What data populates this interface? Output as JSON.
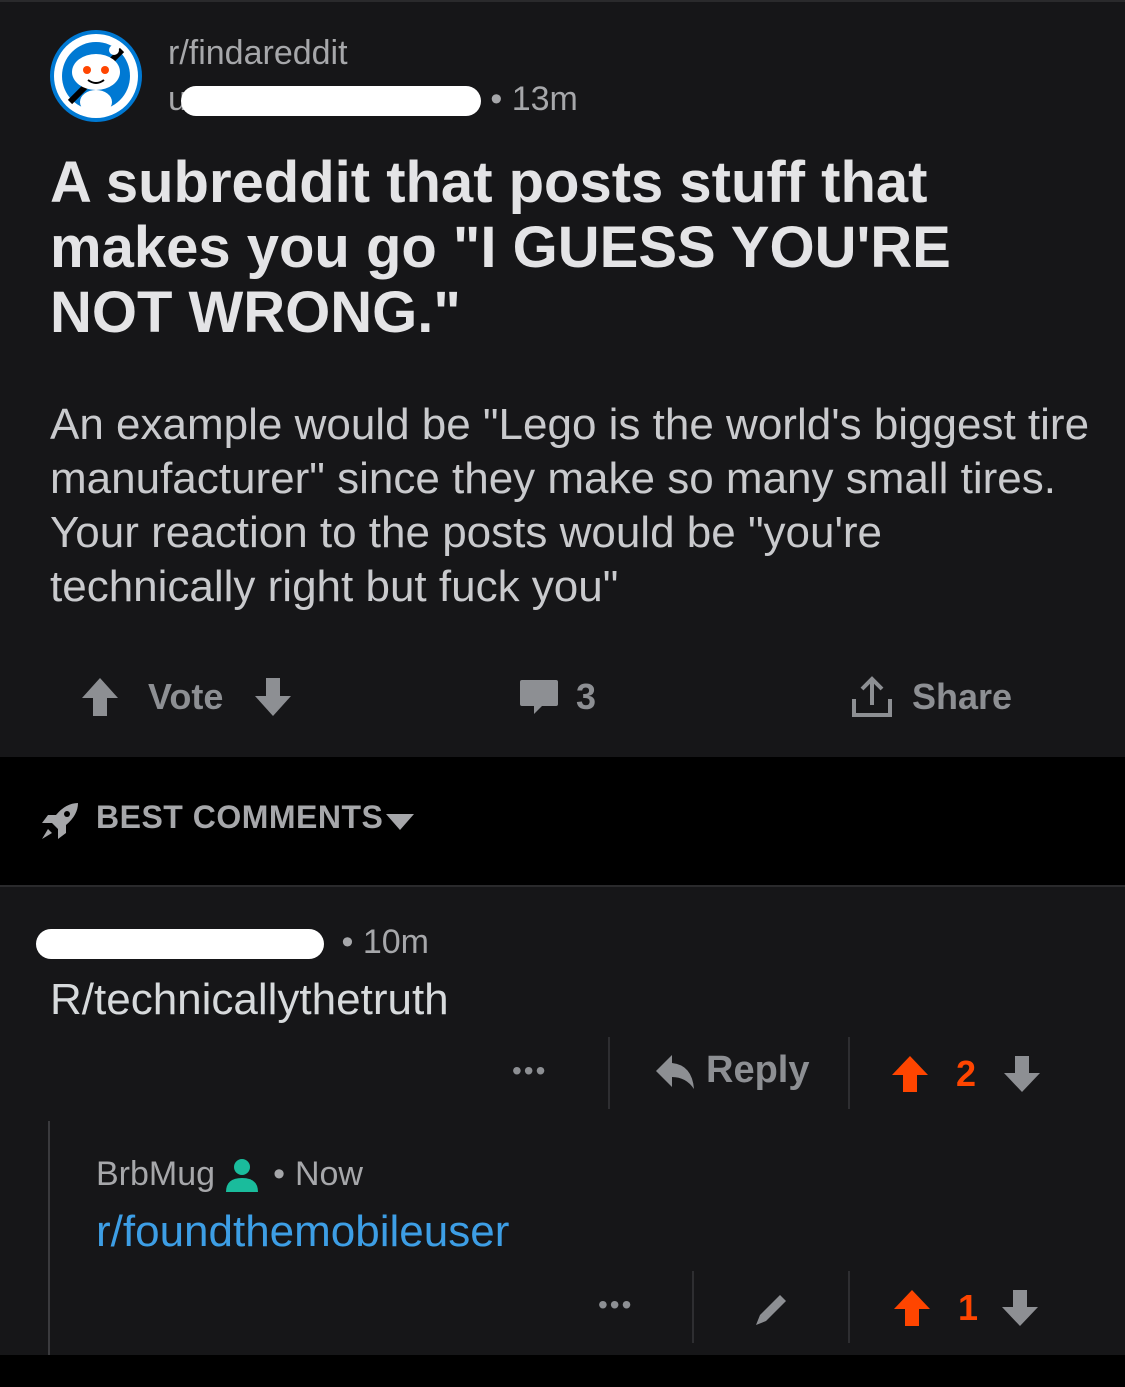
{
  "post": {
    "subreddit": "r/findareddit",
    "author_prefix": "u",
    "time": "13m",
    "title": "A subreddit that posts stuff that makes you go \"I GUESS YOU'RE NOT WRONG.\"",
    "body": "An example would be \"Lego is the world's biggest tire manufacturer\" since they make so many small tires. Your reaction to the posts would be \"you're technically right but fuck you\"",
    "actions": {
      "vote_label": "Vote",
      "comment_count": "3",
      "share_label": "Share"
    }
  },
  "comments_header": {
    "sort_label": "BEST COMMENTS"
  },
  "comments": [
    {
      "time": "10m",
      "body": "R/technicallythetruth",
      "reply_label": "Reply",
      "more_label": "•••",
      "score": "2"
    }
  ],
  "reply": {
    "author": "BrbMug",
    "time": "Now",
    "body": "r/foundthemobileuser",
    "more_label": "•••",
    "score": "1"
  },
  "colors": {
    "upvote": "#ff4500",
    "link": "#3d9ee5",
    "online": "#1abc9c",
    "background": "#161618"
  }
}
